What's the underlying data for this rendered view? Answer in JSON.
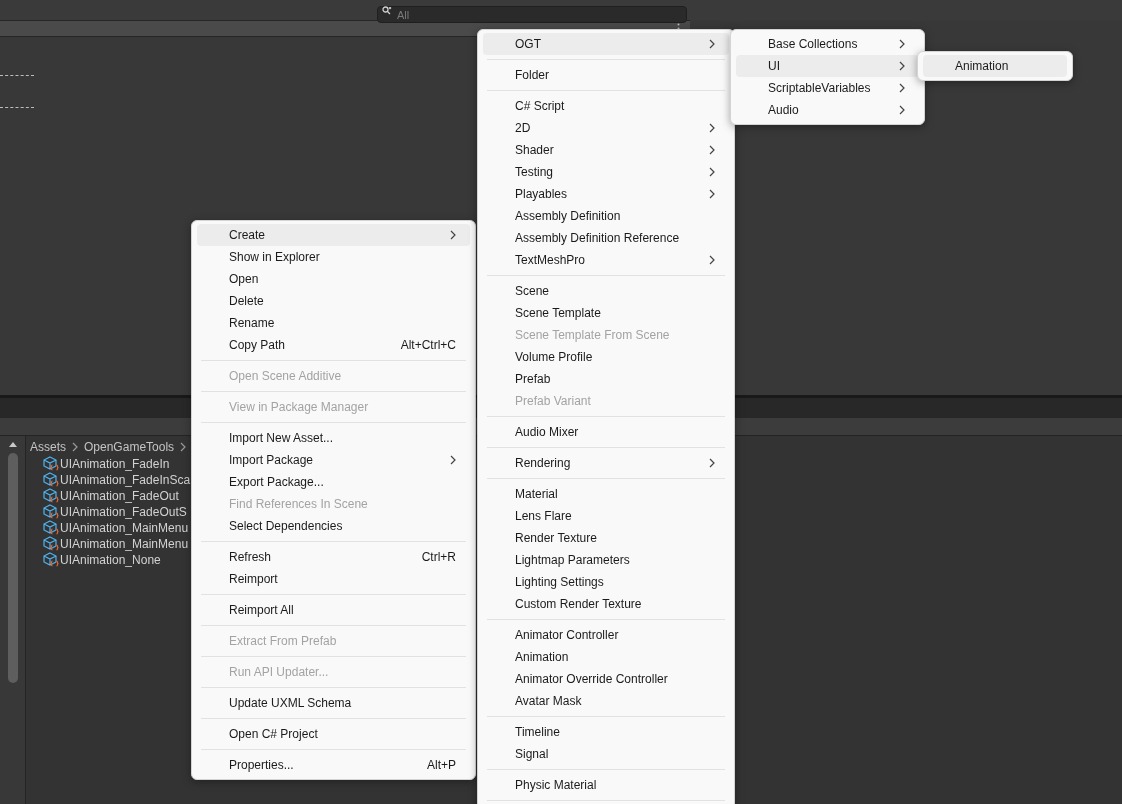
{
  "search": {
    "placeholder": "All"
  },
  "breadcrumb": [
    "Assets",
    "OpenGameTools"
  ],
  "assets": [
    "UIAnimation_FadeIn",
    "UIAnimation_FadeInSca",
    "UIAnimation_FadeOut",
    "UIAnimation_FadeOutS",
    "UIAnimation_MainMenu",
    "UIAnimation_MainMenu",
    "UIAnimation_None"
  ],
  "menus": [
    {
      "items": [
        {
          "kind": "item",
          "label": "Create",
          "submenu": true,
          "disabled": false,
          "selected": true
        },
        {
          "kind": "item",
          "label": "Show in Explorer",
          "submenu": false,
          "disabled": false,
          "selected": false
        },
        {
          "kind": "item",
          "label": "Open",
          "submenu": false,
          "disabled": false,
          "selected": false
        },
        {
          "kind": "item",
          "label": "Delete",
          "submenu": false,
          "disabled": false,
          "selected": false
        },
        {
          "kind": "item",
          "label": "Rename",
          "submenu": false,
          "disabled": false,
          "selected": false
        },
        {
          "kind": "item",
          "label": "Copy Path",
          "shortcut": "Alt+Ctrl+C",
          "submenu": false,
          "disabled": false,
          "selected": false
        },
        {
          "kind": "separator"
        },
        {
          "kind": "item",
          "label": "Open Scene Additive",
          "submenu": false,
          "disabled": true,
          "selected": false
        },
        {
          "kind": "separator"
        },
        {
          "kind": "item",
          "label": "View in Package Manager",
          "submenu": false,
          "disabled": true,
          "selected": false
        },
        {
          "kind": "separator"
        },
        {
          "kind": "item",
          "label": "Import New Asset...",
          "submenu": false,
          "disabled": false,
          "selected": false
        },
        {
          "kind": "item",
          "label": "Import Package",
          "submenu": true,
          "disabled": false,
          "selected": false
        },
        {
          "kind": "item",
          "label": "Export Package...",
          "submenu": false,
          "disabled": false,
          "selected": false
        },
        {
          "kind": "item",
          "label": "Find References In Scene",
          "submenu": false,
          "disabled": true,
          "selected": false
        },
        {
          "kind": "item",
          "label": "Select Dependencies",
          "submenu": false,
          "disabled": false,
          "selected": false
        },
        {
          "kind": "separator"
        },
        {
          "kind": "item",
          "label": "Refresh",
          "shortcut": "Ctrl+R",
          "submenu": false,
          "disabled": false,
          "selected": false
        },
        {
          "kind": "item",
          "label": "Reimport",
          "submenu": false,
          "disabled": false,
          "selected": false
        },
        {
          "kind": "separator"
        },
        {
          "kind": "item",
          "label": "Reimport All",
          "submenu": false,
          "disabled": false,
          "selected": false
        },
        {
          "kind": "separator"
        },
        {
          "kind": "item",
          "label": "Extract From Prefab",
          "submenu": false,
          "disabled": true,
          "selected": false
        },
        {
          "kind": "separator"
        },
        {
          "kind": "item",
          "label": "Run API Updater...",
          "submenu": false,
          "disabled": true,
          "selected": false
        },
        {
          "kind": "separator"
        },
        {
          "kind": "item",
          "label": "Update UXML Schema",
          "submenu": false,
          "disabled": false,
          "selected": false
        },
        {
          "kind": "separator"
        },
        {
          "kind": "item",
          "label": "Open C# Project",
          "submenu": false,
          "disabled": false,
          "selected": false
        },
        {
          "kind": "separator"
        },
        {
          "kind": "item",
          "label": "Properties...",
          "shortcut": "Alt+P",
          "submenu": false,
          "disabled": false,
          "selected": false
        }
      ]
    },
    {
      "items": [
        {
          "kind": "item",
          "label": "OGT",
          "submenu": true,
          "disabled": false,
          "selected": true
        },
        {
          "kind": "separator"
        },
        {
          "kind": "item",
          "label": "Folder",
          "submenu": false,
          "disabled": false,
          "selected": false
        },
        {
          "kind": "separator"
        },
        {
          "kind": "item",
          "label": "C# Script",
          "submenu": false,
          "disabled": false,
          "selected": false
        },
        {
          "kind": "item",
          "label": "2D",
          "submenu": true,
          "disabled": false,
          "selected": false
        },
        {
          "kind": "item",
          "label": "Shader",
          "submenu": true,
          "disabled": false,
          "selected": false
        },
        {
          "kind": "item",
          "label": "Testing",
          "submenu": true,
          "disabled": false,
          "selected": false
        },
        {
          "kind": "item",
          "label": "Playables",
          "submenu": true,
          "disabled": false,
          "selected": false
        },
        {
          "kind": "item",
          "label": "Assembly Definition",
          "submenu": false,
          "disabled": false,
          "selected": false
        },
        {
          "kind": "item",
          "label": "Assembly Definition Reference",
          "submenu": false,
          "disabled": false,
          "selected": false
        },
        {
          "kind": "item",
          "label": "TextMeshPro",
          "submenu": true,
          "disabled": false,
          "selected": false
        },
        {
          "kind": "separator"
        },
        {
          "kind": "item",
          "label": "Scene",
          "submenu": false,
          "disabled": false,
          "selected": false
        },
        {
          "kind": "item",
          "label": "Scene Template",
          "submenu": false,
          "disabled": false,
          "selected": false
        },
        {
          "kind": "item",
          "label": "Scene Template From Scene",
          "submenu": false,
          "disabled": true,
          "selected": false
        },
        {
          "kind": "item",
          "label": "Volume Profile",
          "submenu": false,
          "disabled": false,
          "selected": false
        },
        {
          "kind": "item",
          "label": "Prefab",
          "submenu": false,
          "disabled": false,
          "selected": false
        },
        {
          "kind": "item",
          "label": "Prefab Variant",
          "submenu": false,
          "disabled": true,
          "selected": false
        },
        {
          "kind": "separator"
        },
        {
          "kind": "item",
          "label": "Audio Mixer",
          "submenu": false,
          "disabled": false,
          "selected": false
        },
        {
          "kind": "separator"
        },
        {
          "kind": "item",
          "label": "Rendering",
          "submenu": true,
          "disabled": false,
          "selected": false
        },
        {
          "kind": "separator"
        },
        {
          "kind": "item",
          "label": "Material",
          "submenu": false,
          "disabled": false,
          "selected": false
        },
        {
          "kind": "item",
          "label": "Lens Flare",
          "submenu": false,
          "disabled": false,
          "selected": false
        },
        {
          "kind": "item",
          "label": "Render Texture",
          "submenu": false,
          "disabled": false,
          "selected": false
        },
        {
          "kind": "item",
          "label": "Lightmap Parameters",
          "submenu": false,
          "disabled": false,
          "selected": false
        },
        {
          "kind": "item",
          "label": "Lighting Settings",
          "submenu": false,
          "disabled": false,
          "selected": false
        },
        {
          "kind": "item",
          "label": "Custom Render Texture",
          "submenu": false,
          "disabled": false,
          "selected": false
        },
        {
          "kind": "separator"
        },
        {
          "kind": "item",
          "label": "Animator Controller",
          "submenu": false,
          "disabled": false,
          "selected": false
        },
        {
          "kind": "item",
          "label": "Animation",
          "submenu": false,
          "disabled": false,
          "selected": false
        },
        {
          "kind": "item",
          "label": "Animator Override Controller",
          "submenu": false,
          "disabled": false,
          "selected": false
        },
        {
          "kind": "item",
          "label": "Avatar Mask",
          "submenu": false,
          "disabled": false,
          "selected": false
        },
        {
          "kind": "separator"
        },
        {
          "kind": "item",
          "label": "Timeline",
          "submenu": false,
          "disabled": false,
          "selected": false
        },
        {
          "kind": "item",
          "label": "Signal",
          "submenu": false,
          "disabled": false,
          "selected": false
        },
        {
          "kind": "separator"
        },
        {
          "kind": "item",
          "label": "Physic Material",
          "submenu": false,
          "disabled": false,
          "selected": false
        },
        {
          "kind": "separator"
        }
      ]
    },
    {
      "items": [
        {
          "kind": "item",
          "label": "Base Collections",
          "submenu": true,
          "disabled": false,
          "selected": false
        },
        {
          "kind": "item",
          "label": "UI",
          "submenu": true,
          "disabled": false,
          "selected": true
        },
        {
          "kind": "item",
          "label": "ScriptableVariables",
          "submenu": true,
          "disabled": false,
          "selected": false
        },
        {
          "kind": "item",
          "label": "Audio",
          "submenu": true,
          "disabled": false,
          "selected": false
        }
      ]
    },
    {
      "items": [
        {
          "kind": "item",
          "label": "Animation",
          "submenu": false,
          "disabled": false,
          "selected": true
        }
      ]
    }
  ]
}
